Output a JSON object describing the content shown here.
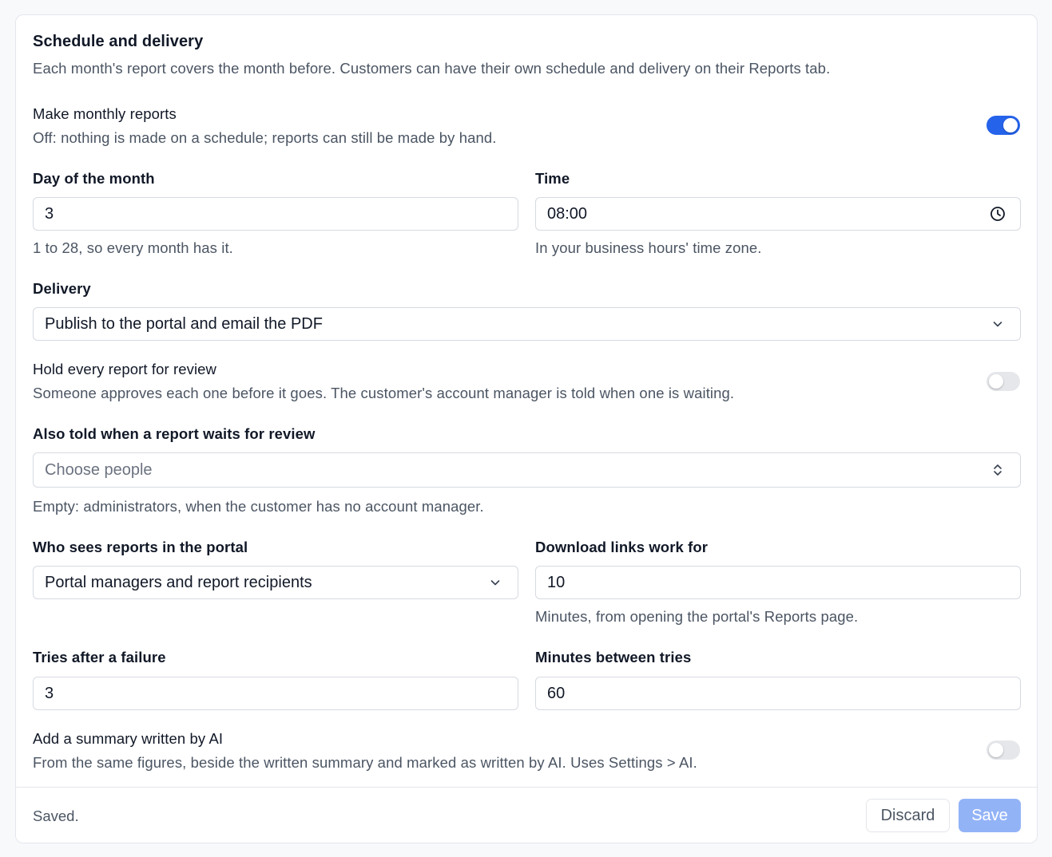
{
  "section": {
    "title": "Schedule and delivery",
    "description": "Each month's report covers the month before. Customers can have their own schedule and delivery on their Reports tab."
  },
  "monthly_reports": {
    "label": "Make monthly reports",
    "hint": "Off: nothing is made on a schedule; reports can still be made by hand.",
    "enabled": true
  },
  "day_of_month": {
    "label": "Day of the month",
    "value": "3",
    "hint": "1 to 28, so every month has it."
  },
  "time": {
    "label": "Time",
    "value": "08:00",
    "hint": "In your business hours' time zone."
  },
  "delivery": {
    "label": "Delivery",
    "selected": "Publish to the portal and email the PDF"
  },
  "hold_review": {
    "label": "Hold every report for review",
    "hint": "Someone approves each one before it goes. The customer's account manager is told when one is waiting.",
    "enabled": false
  },
  "review_notify": {
    "label": "Also told when a report waits for review",
    "placeholder": "Choose people",
    "hint": "Empty: administrators, when the customer has no account manager."
  },
  "portal_visibility": {
    "label": "Who sees reports in the portal",
    "selected": "Portal managers and report recipients"
  },
  "download_links": {
    "label": "Download links work for",
    "value": "10",
    "hint": "Minutes, from opening the portal's Reports page."
  },
  "retries": {
    "label": "Tries after a failure",
    "value": "3"
  },
  "retry_interval": {
    "label": "Minutes between tries",
    "value": "60"
  },
  "ai_summary": {
    "label": "Add a summary written by AI",
    "hint": "From the same figures, beside the written summary and marked as written by AI. Uses Settings > AI.",
    "enabled": false
  },
  "footer": {
    "status": "Saved.",
    "discard_label": "Discard",
    "save_label": "Save"
  },
  "colors": {
    "accent": "#2563eb",
    "save_disabled": "#93b3f7"
  }
}
